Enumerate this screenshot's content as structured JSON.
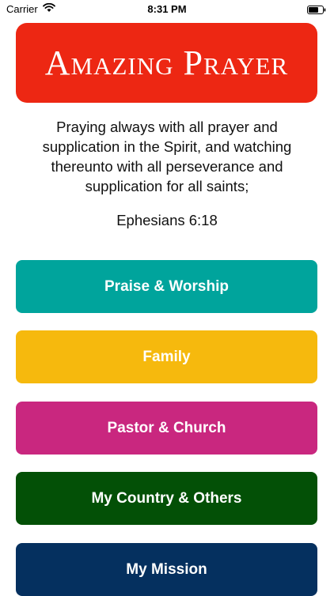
{
  "status_bar": {
    "carrier": "Carrier",
    "time": "8:31 PM"
  },
  "header": {
    "title": "Amazing Prayer"
  },
  "verse": {
    "text": "Praying always with all prayer and supplication in the Spirit, and watching thereunto with all perseverance and supplication for all saints;",
    "reference": "Ephesians 6:18"
  },
  "menu": {
    "items": [
      {
        "label": "Praise & Worship",
        "color": "#00a49c"
      },
      {
        "label": "Family",
        "color": "#f6b90d"
      },
      {
        "label": "Pastor & Church",
        "color": "#c9277f"
      },
      {
        "label": "My Country & Others",
        "color": "#035006"
      },
      {
        "label": "My Mission",
        "color": "#05305f"
      }
    ]
  },
  "colors": {
    "title_banner": "#ed2713"
  }
}
